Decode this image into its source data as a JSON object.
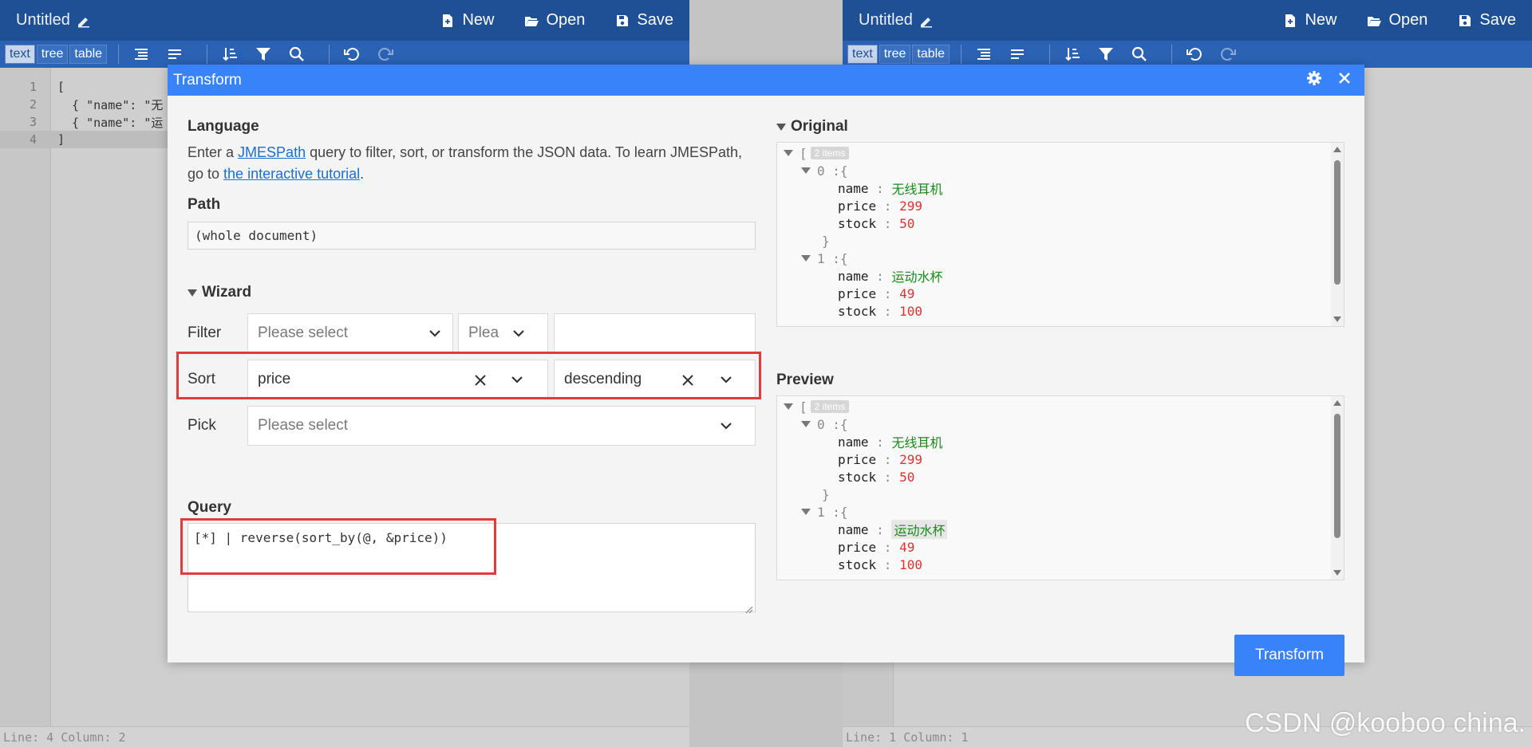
{
  "left_editor": {
    "title": "Untitled",
    "menu": {
      "new": "New",
      "open": "Open",
      "save": "Save"
    },
    "modes": [
      "text",
      "tree",
      "table"
    ],
    "line_numbers": [
      "1",
      "2",
      "3",
      "4"
    ],
    "lines": [
      "[",
      "  { \"name\": \"无",
      "  { \"name\": \"运",
      "]"
    ],
    "status": "Line: 4  Column: 2"
  },
  "right_editor": {
    "title": "Untitled",
    "menu": {
      "new": "New",
      "open": "Open",
      "save": "Save"
    },
    "modes": [
      "text",
      "tree",
      "table"
    ],
    "status": "Line: 1  Column: 1"
  },
  "modal": {
    "title": "Transform",
    "language": {
      "heading": "Language",
      "text_before": "Enter a ",
      "link1": "JMESPath",
      "text_middle": " query to filter, sort, or transform the JSON data. To learn JMESPath, go to ",
      "link2": "the interactive tutorial",
      "text_after": "."
    },
    "path": {
      "heading": "Path",
      "value": "(whole document)"
    },
    "wizard": {
      "heading": "Wizard",
      "filter": {
        "label": "Filter",
        "field_placeholder": "Please select",
        "relation_placeholder": "Plea",
        "value": ""
      },
      "sort": {
        "label": "Sort",
        "field": "price",
        "direction": "descending"
      },
      "pick": {
        "label": "Pick",
        "placeholder": "Please select"
      }
    },
    "query": {
      "heading": "Query",
      "value": "[*] | reverse(sort_by(@, &price))"
    },
    "original": {
      "heading": "Original",
      "badge": "2 items",
      "items": [
        {
          "index": "0",
          "name": "无线耳机",
          "price": "299",
          "stock": "50"
        },
        {
          "index": "1",
          "name": "运动水杯",
          "price": "49",
          "stock": "100"
        }
      ]
    },
    "preview": {
      "heading": "Preview",
      "badge": "2 items",
      "items": [
        {
          "index": "0",
          "name": "无线耳机",
          "price": "299",
          "stock": "50"
        },
        {
          "index": "1",
          "name": "运动水杯",
          "price": "49",
          "stock": "100"
        }
      ]
    },
    "transform_button": "Transform"
  },
  "watermark": "CSDN @kooboo china."
}
